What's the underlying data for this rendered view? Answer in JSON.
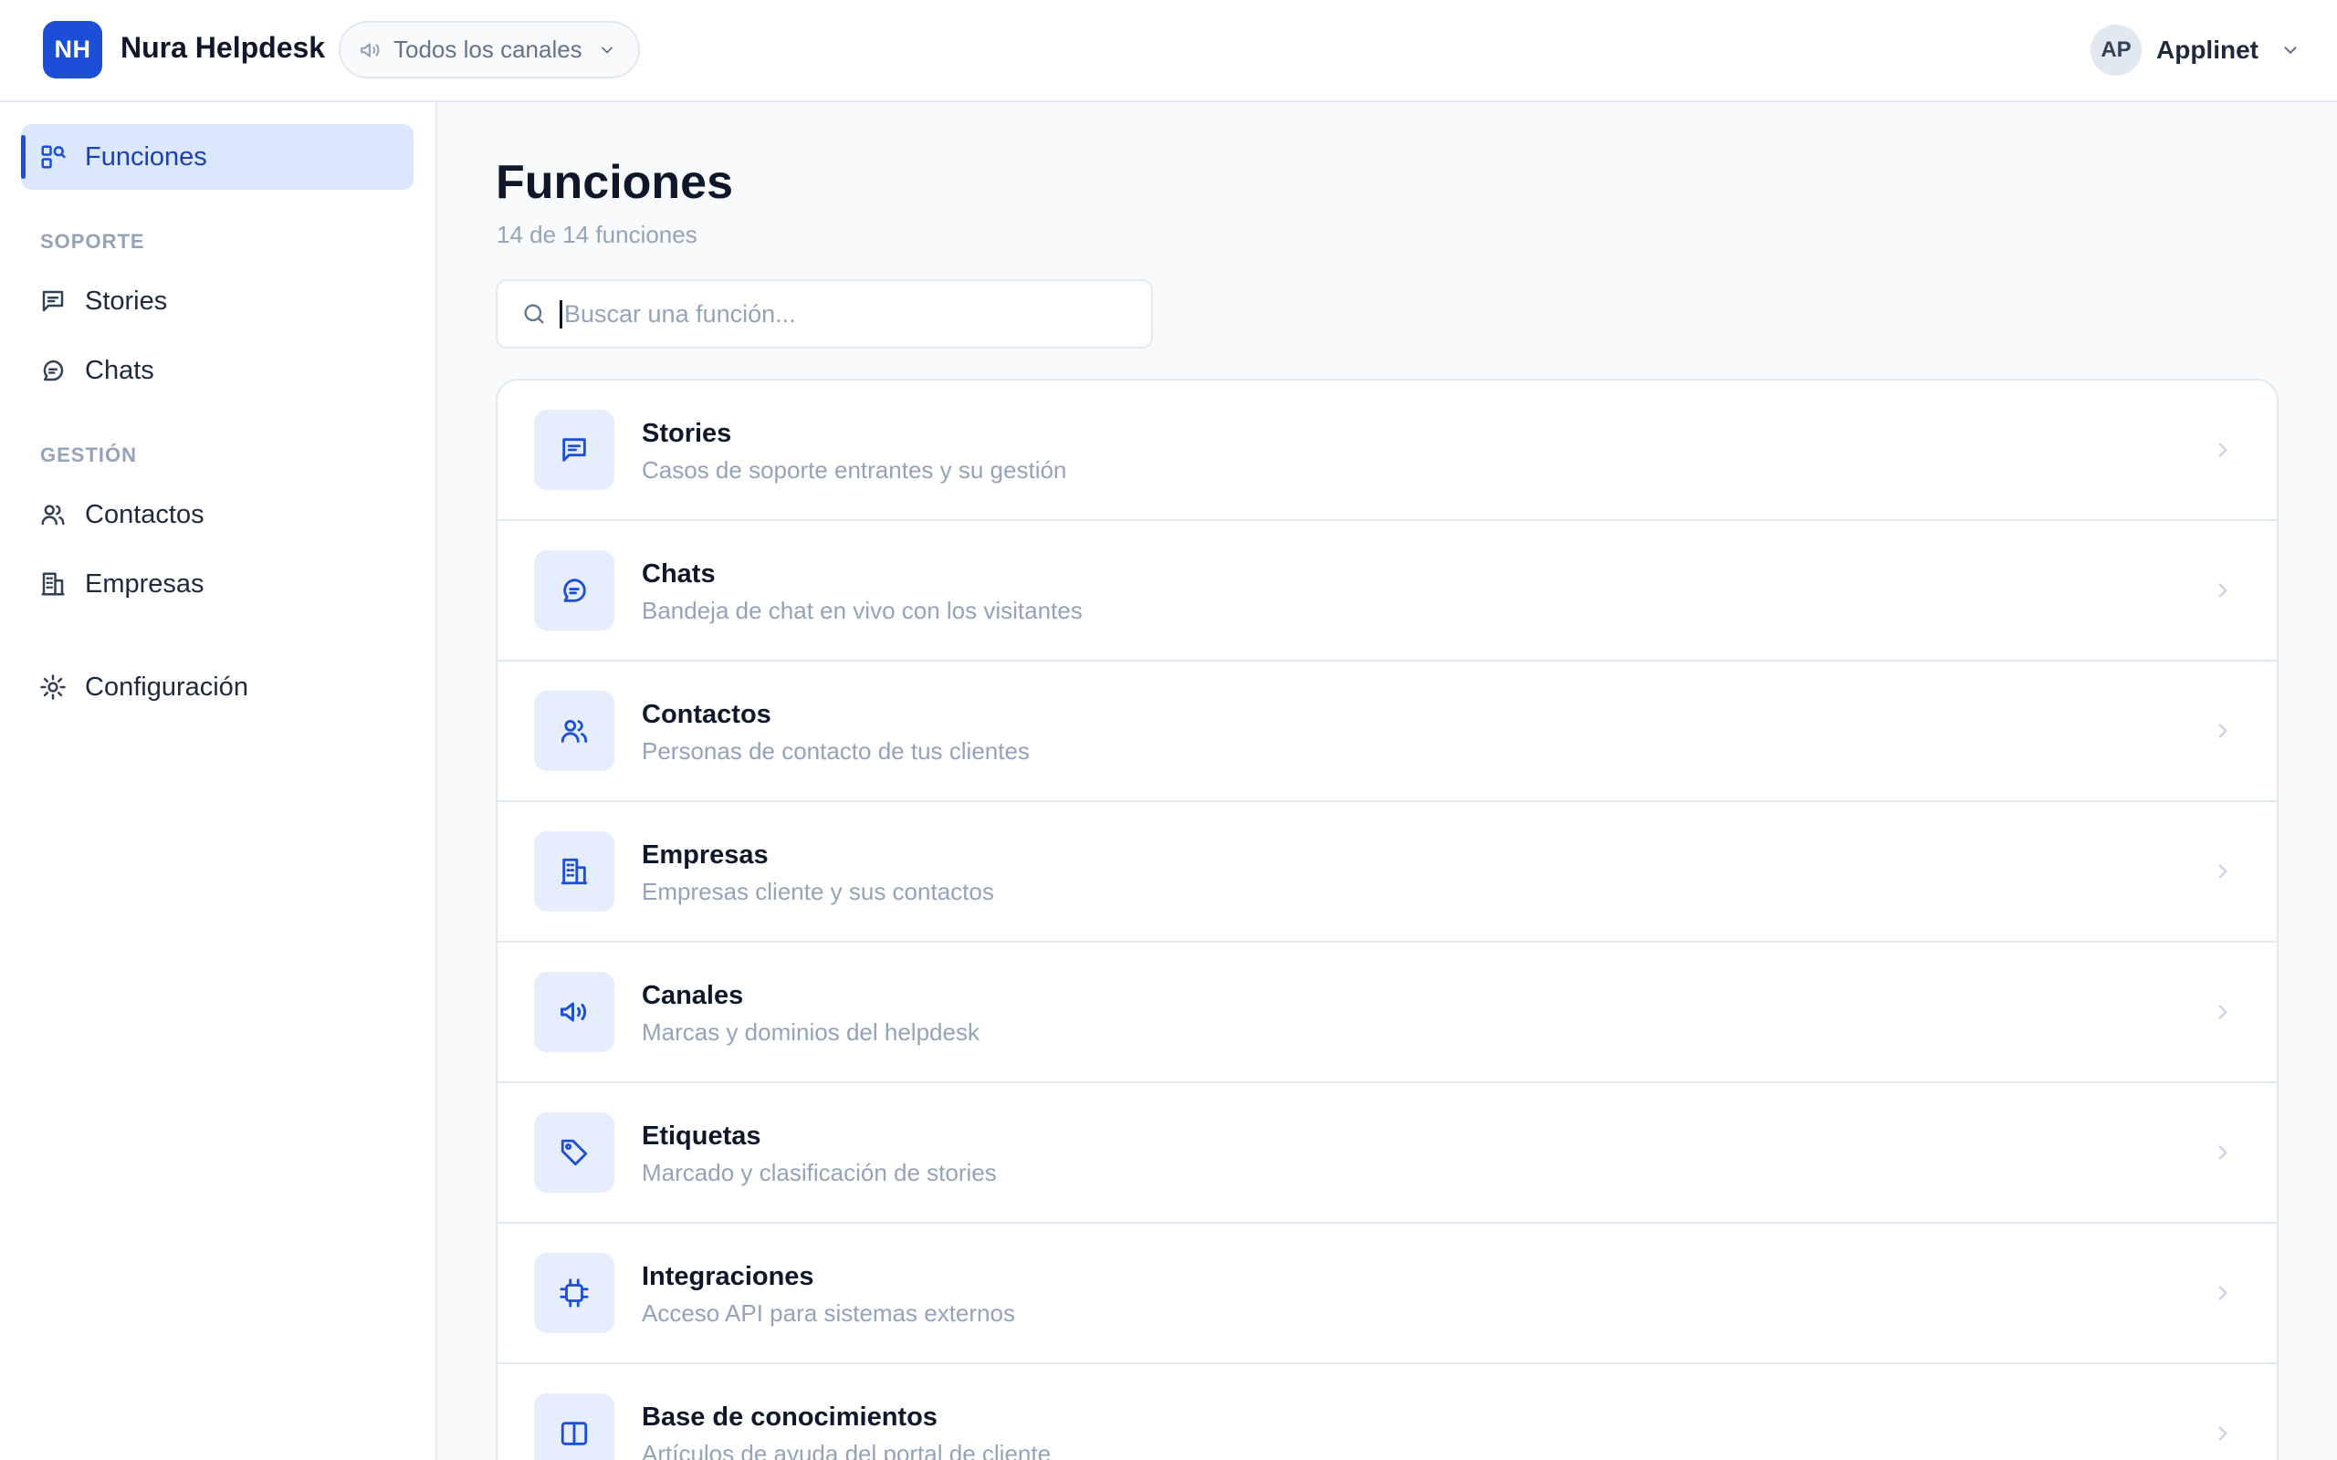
{
  "app": {
    "logo_text": "NH",
    "name": "Nura Helpdesk",
    "brand_color": "#1d4ed8"
  },
  "channel_selector": {
    "icon": "megaphone-icon",
    "value": "Todos los canales"
  },
  "user": {
    "initials": "AP",
    "name": "Applinet"
  },
  "sidebar": {
    "active": {
      "label": "Funciones",
      "icon": "functions-icon"
    },
    "sections": [
      {
        "title": "SOPORTE",
        "items": [
          {
            "label": "Stories",
            "icon": "message-square-icon"
          },
          {
            "label": "Chats",
            "icon": "chat-bubble-icon"
          }
        ]
      },
      {
        "title": "GESTIÓN",
        "items": [
          {
            "label": "Contactos",
            "icon": "users-icon"
          },
          {
            "label": "Empresas",
            "icon": "building-icon"
          }
        ]
      }
    ],
    "settings": {
      "label": "Configuración",
      "icon": "gear-icon"
    }
  },
  "main": {
    "title": "Funciones",
    "subtitle": "14 de 14 funciones",
    "search_placeholder": "Buscar una función...",
    "search_value": "",
    "features": [
      {
        "title": "Stories",
        "description": "Casos de soporte entrantes y su gestión",
        "icon": "message-square-icon"
      },
      {
        "title": "Chats",
        "description": "Bandeja de chat en vivo con los visitantes",
        "icon": "chat-bubble-icon"
      },
      {
        "title": "Contactos",
        "description": "Personas de contacto de tus clientes",
        "icon": "users-icon"
      },
      {
        "title": "Empresas",
        "description": "Empresas cliente y sus contactos",
        "icon": "building-icon"
      },
      {
        "title": "Canales",
        "description": "Marcas y dominios del helpdesk",
        "icon": "megaphone-icon"
      },
      {
        "title": "Etiquetas",
        "description": "Marcado y clasificación de stories",
        "icon": "tag-icon"
      },
      {
        "title": "Integraciones",
        "description": "Acceso API para sistemas externos",
        "icon": "chip-icon"
      },
      {
        "title": "Base de conocimientos",
        "description": "Artículos de ayuda del portal de cliente",
        "icon": "book-open-icon"
      }
    ]
  }
}
